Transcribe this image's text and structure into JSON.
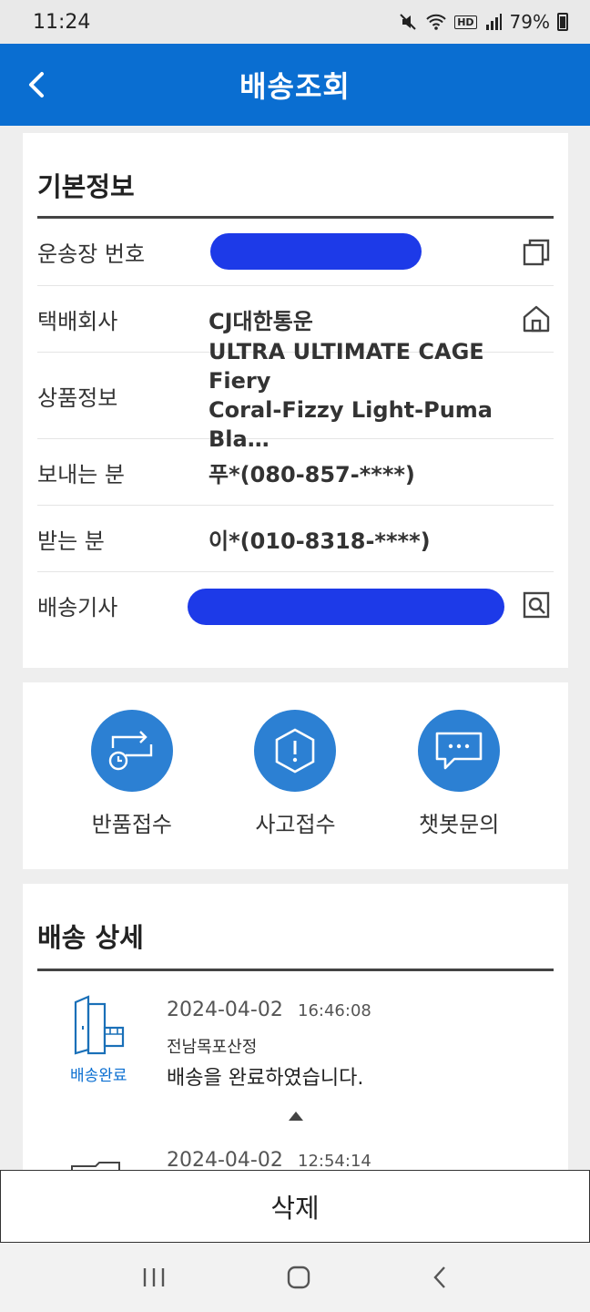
{
  "status_bar": {
    "time": "11:24",
    "network_label": "HD",
    "battery": "79%"
  },
  "header": {
    "title": "배송조회",
    "back_icon": "chevron-left-icon"
  },
  "basic_info": {
    "title": "기본정보",
    "rows": [
      {
        "label": "운송장 번호",
        "value": "",
        "redacted": true,
        "action_icon": "copy-icon"
      },
      {
        "label": "택배회사",
        "value": "CJ대한통운",
        "action_icon": "home-icon"
      },
      {
        "label": "상품정보",
        "value_line1": "ULTRA ULTIMATE CAGE Fiery",
        "value_line2": "Coral-Fizzy Light-Puma Bla…"
      },
      {
        "label": "보내는 분",
        "value": "푸*(080-857-****)"
      },
      {
        "label": "받는 분",
        "value": "이*(010-8318-****)"
      },
      {
        "label": "배송기사",
        "value": "",
        "redacted": true,
        "action_icon": "search-document-icon"
      }
    ]
  },
  "actions": [
    {
      "label": "반품접수",
      "icon": "return-icon"
    },
    {
      "label": "사고접수",
      "icon": "alert-hexagon-icon"
    },
    {
      "label": "챗봇문의",
      "icon": "chat-icon"
    }
  ],
  "delivery_detail": {
    "title": "배송 상세",
    "items": [
      {
        "date": "2024-04-02",
        "time": "16:46:08",
        "location": "전남목포산정",
        "message": "배송을 완료하였습니다.",
        "status": "배송완료"
      },
      {
        "date": "2024-04-02",
        "time": "12:54:14"
      }
    ]
  },
  "footer": {
    "delete_label": "삭제"
  },
  "colors": {
    "brand": "#0a6ed1",
    "action_circle": "#2c80d3",
    "redaction": "#1d3ae8"
  }
}
